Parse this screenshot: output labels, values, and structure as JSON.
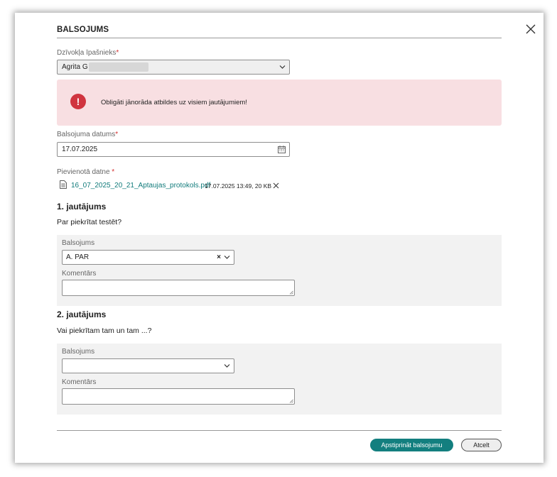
{
  "dialog": {
    "title": "BALSOJUMS"
  },
  "owner": {
    "label": "Dzīvokļa īpašnieks",
    "required_mark": "*",
    "value": "Agrita G"
  },
  "alert": {
    "icon": "exclamation-icon",
    "message": "Obligāti jānorāda atbildes uz visiem jautājumiem!",
    "color": "#d0343f",
    "background": "#f8dfe2"
  },
  "vote_date": {
    "label": "Balsojuma datums",
    "required_mark": "*",
    "value": "17.07.2025"
  },
  "attachment": {
    "label": "Pievienotā datne",
    "required_mark": "*",
    "file_name": "16_07_2025_20_21_Aptaujas_protokols.pdf",
    "meta": "17.07.2025 13:49, 20 KB"
  },
  "questions": [
    {
      "heading": "1. jautājums",
      "text": "Par piekrītat testēt?",
      "vote_label": "Balsojums",
      "vote_value": "A. PAR",
      "comment_label": "Komentārs",
      "comment_value": ""
    },
    {
      "heading": "2. jautājums",
      "text": "Vai piekrītam tam un tam ...?",
      "vote_label": "Balsojums",
      "vote_value": "",
      "comment_label": "Komentārs",
      "comment_value": ""
    }
  ],
  "footer": {
    "confirm_label": "Apstiprināt balsojumu",
    "cancel_label": "Atcelt",
    "accent_color": "#137f7f"
  }
}
